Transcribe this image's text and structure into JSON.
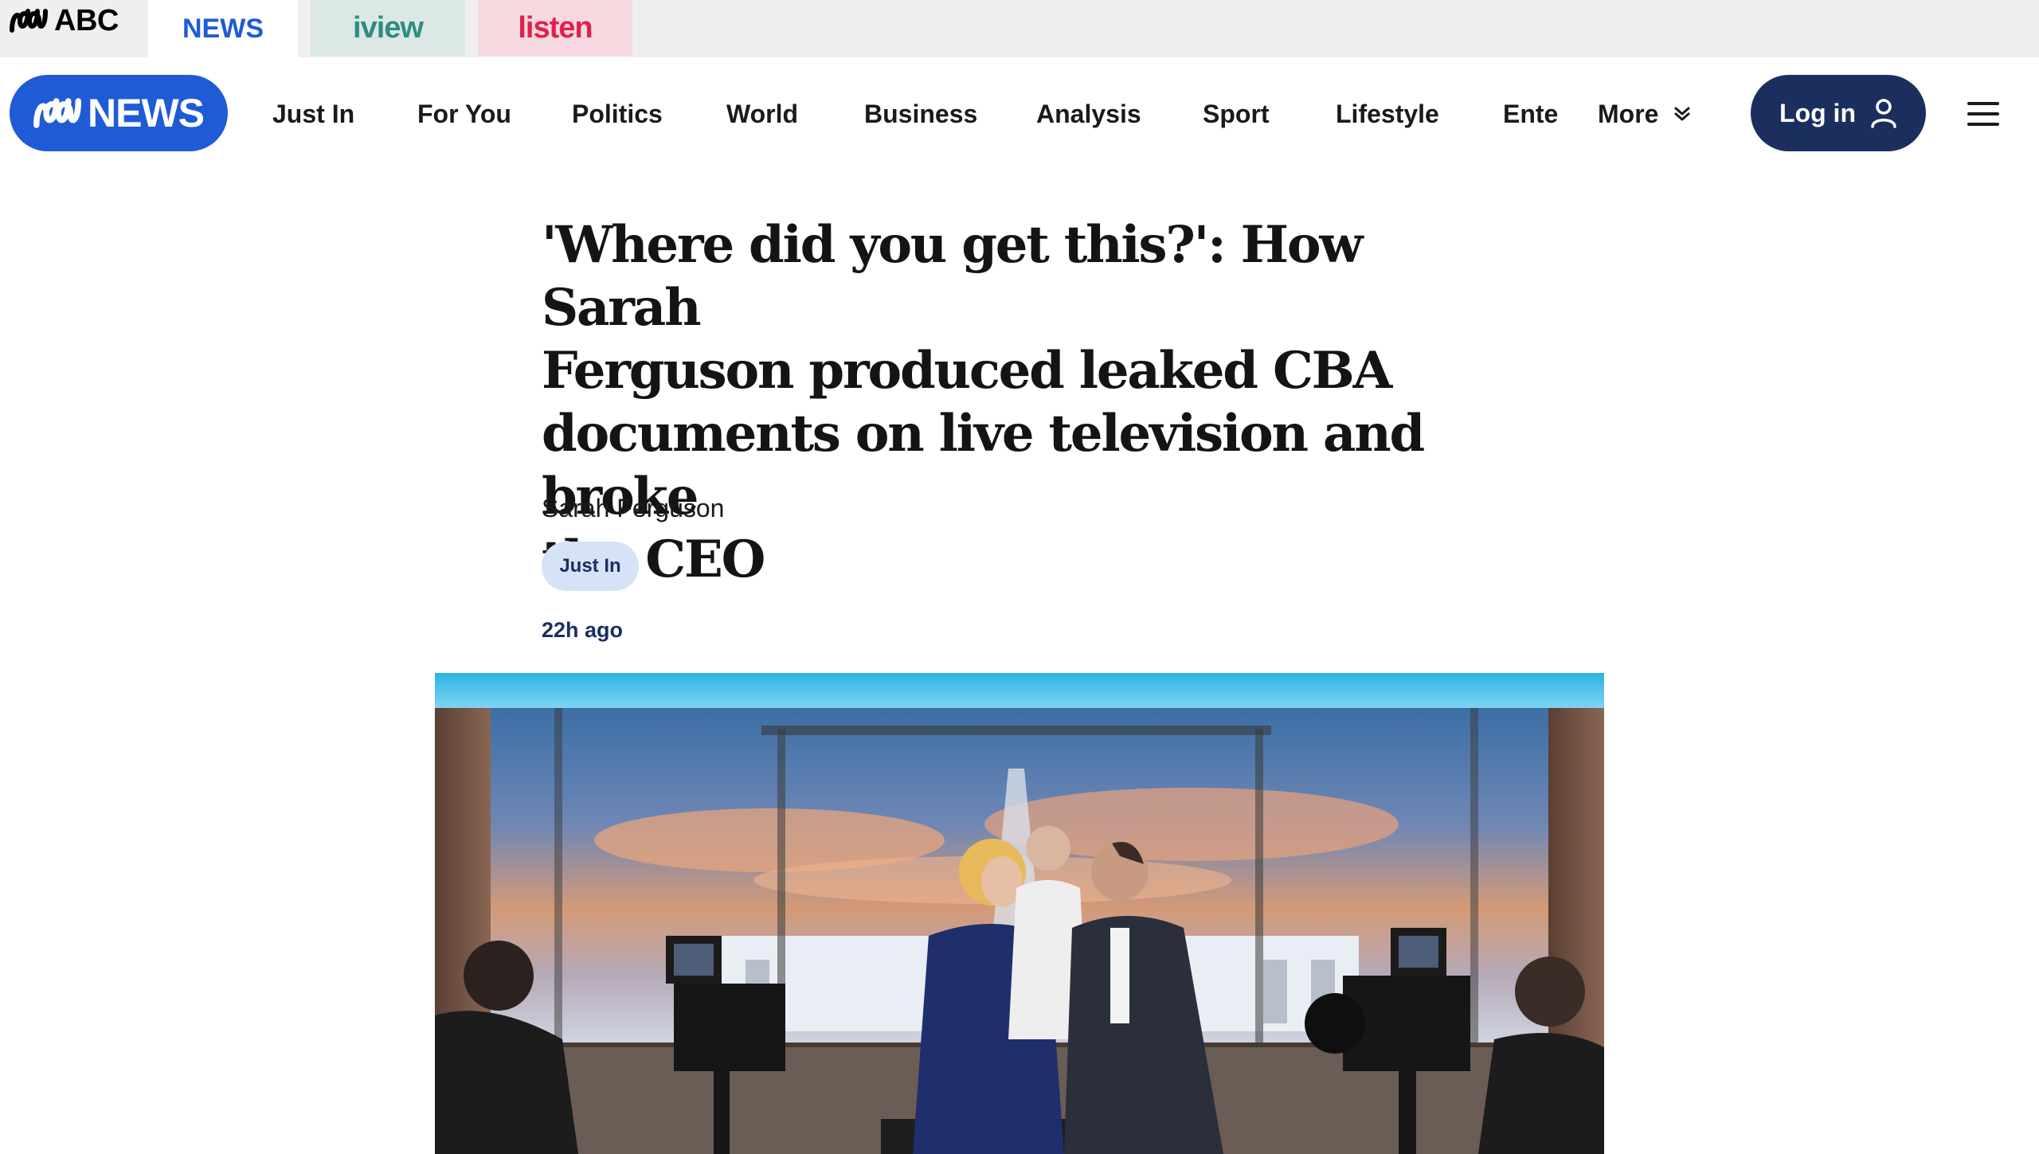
{
  "network_bar": {
    "brand": "ABC",
    "tabs": [
      {
        "label": "NEWS",
        "active": true
      },
      {
        "label": "iview",
        "active": false
      },
      {
        "label": "listen",
        "active": false
      }
    ]
  },
  "main_nav": {
    "logo_text": "NEWS",
    "items": [
      "Just In",
      "For You",
      "Politics",
      "World",
      "Business",
      "Analysis",
      "Sport",
      "Lifestyle",
      "Ente"
    ],
    "more_label": "More",
    "login_label": "Log in"
  },
  "article": {
    "headline_lines": [
      "'Where did you get this?': How Sarah",
      "Ferguson produced leaked CBA",
      "documents on live television and broke",
      "the CEO"
    ],
    "author": "Sarah Ferguson",
    "tag": "Just In",
    "timestamp": "22h ago"
  },
  "colors": {
    "news_blue": "#1f5bd6",
    "navy": "#1b2f5e",
    "iview_teal": "#2f8c82",
    "listen_red": "#e0214e",
    "tag_bg": "#d6e2f5"
  },
  "icons": {
    "abc_logo": "abc-lissajous-icon",
    "more_chevron": "double-chevron-down-icon",
    "login_user": "user-icon",
    "menu": "hamburger-menu-icon"
  }
}
